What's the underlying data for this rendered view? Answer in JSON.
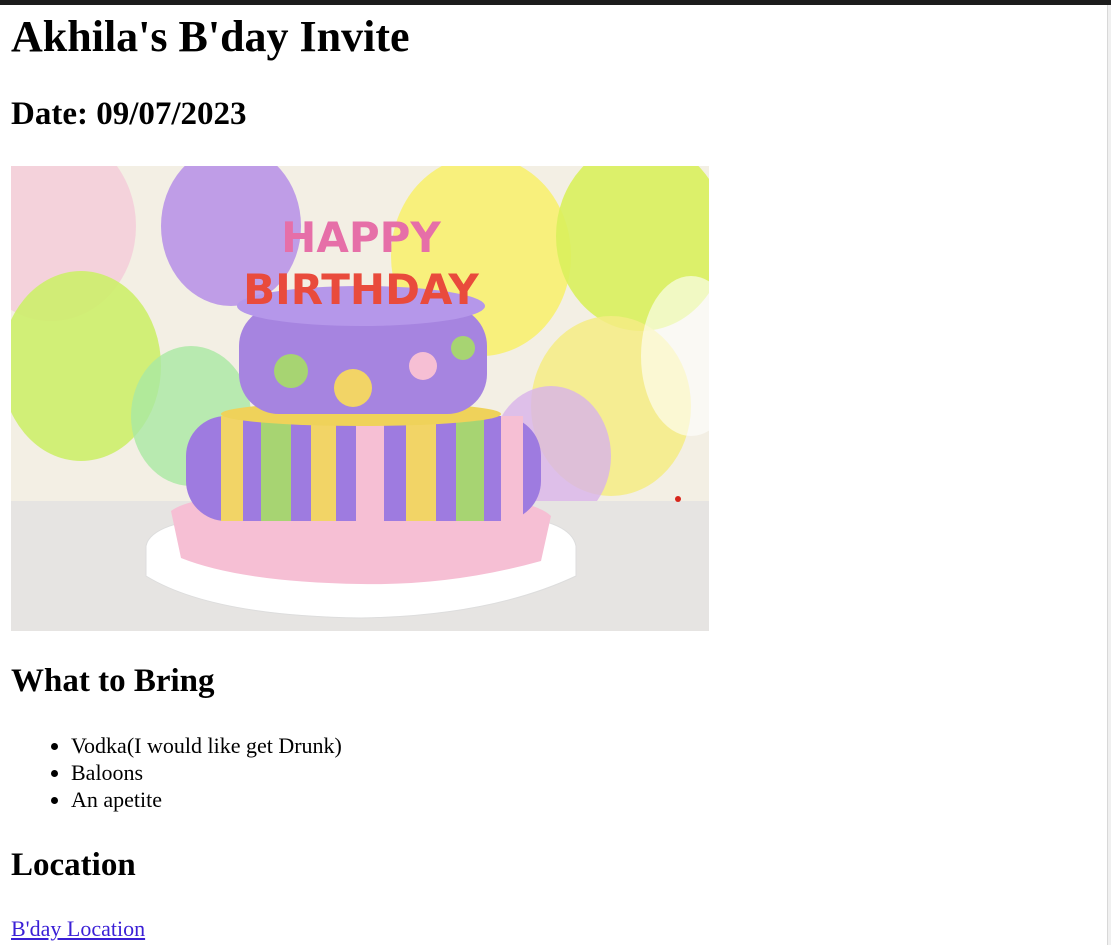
{
  "page": {
    "title": "Akhila's B'day Invite",
    "date": "Date: 09/07/2023"
  },
  "image": {
    "name": "birthday-cake-image",
    "candle_text_top": "HAPPY",
    "candle_text_bottom": "BIRTHDAY"
  },
  "bring": {
    "heading": "What to Bring",
    "items": [
      "Vodka(I would like get Drunk)",
      "Baloons",
      "An apetite"
    ]
  },
  "location": {
    "heading": "Location",
    "link_label": "B'day Location"
  },
  "colors": {
    "link": "#3a1fd6",
    "top_bar": "#1c1c1c"
  }
}
